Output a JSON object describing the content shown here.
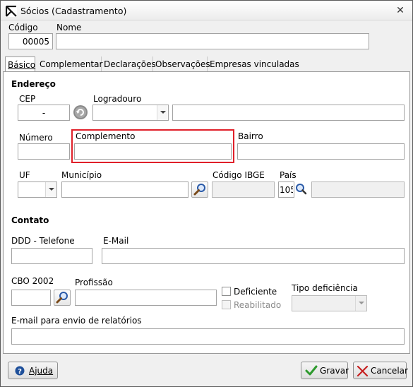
{
  "window": {
    "title": "Sócios (Cadastramento)",
    "close_glyph": "✕"
  },
  "header": {
    "codigo_label": "Código",
    "codigo_value": "00005",
    "nome_label": "Nome",
    "nome_value": ""
  },
  "tabs": [
    {
      "label": "Básico",
      "active": true
    },
    {
      "label": "Complementar",
      "active": false
    },
    {
      "label": "Declarações",
      "active": false
    },
    {
      "label": "Observações",
      "active": false
    },
    {
      "label": "Empresas vinculadas",
      "active": false
    }
  ],
  "endereco": {
    "section_label": "Endereço",
    "cep_label": "CEP",
    "cep_value": "-",
    "logradouro_label": "Logradouro",
    "numero_label": "Número",
    "complemento_label": "Complemento",
    "bairro_label": "Bairro",
    "uf_label": "UF",
    "municipio_label": "Município",
    "codigo_ibge_label": "Código IBGE",
    "pais_label": "País",
    "pais_value": "105"
  },
  "contato": {
    "section_label": "Contato",
    "ddd_telefone_label": "DDD - Telefone",
    "email_label": "E-Mail",
    "cbo_label": "CBO 2002",
    "profissao_label": "Profissão",
    "deficiente_label": "Deficiente",
    "reabilitado_label": "Reabilitado",
    "tipo_deficiencia_label": "Tipo deficiência",
    "email_relatorios_label": "E-mail para envio de relatórios"
  },
  "footer": {
    "ajuda_label": "Ajuda",
    "gravar_label": "Gravar",
    "cancelar_label": "Cancelar"
  },
  "colors": {
    "highlight": "#e0202a",
    "accent_blue": "#1d4f9a",
    "ok_green": "#2e9a2e",
    "cancel_red": "#c62222"
  },
  "icons": [
    "app-logo-icon",
    "close-icon",
    "refresh-icon",
    "search-icon",
    "help-icon",
    "check-icon",
    "x-icon"
  ]
}
